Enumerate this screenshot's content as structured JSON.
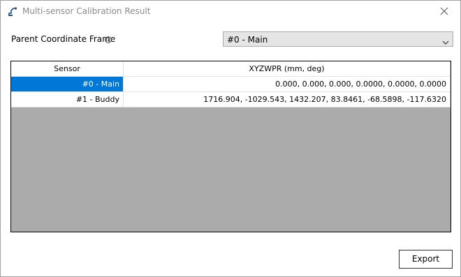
{
  "window": {
    "title": "Multi-sensor Calibration Result"
  },
  "parent_frame": {
    "label": "Parent Coordinate Frame",
    "selected": "#0 - Main"
  },
  "table": {
    "headers": [
      "Sensor",
      "XYZWPR (mm, deg)"
    ],
    "rows": [
      {
        "sensor": "#0 - Main",
        "xyzwpr": "0.000, 0.000, 0.000, 0.0000, 0.0000, 0.0000",
        "selected": true
      },
      {
        "sensor": "#1 - Buddy",
        "xyzwpr": "1716.904, -1029.543, 1432.207, 83.8461, -68.5898, -117.6320",
        "selected": false
      }
    ]
  },
  "actions": {
    "export_label": "Export"
  },
  "colors": {
    "selection": "#0078d7",
    "grid_background": "#ababab"
  },
  "icons": {
    "app": "robot-icon",
    "close": "close-icon",
    "info": "info-icon",
    "dropdown": "chevron-down-icon"
  }
}
